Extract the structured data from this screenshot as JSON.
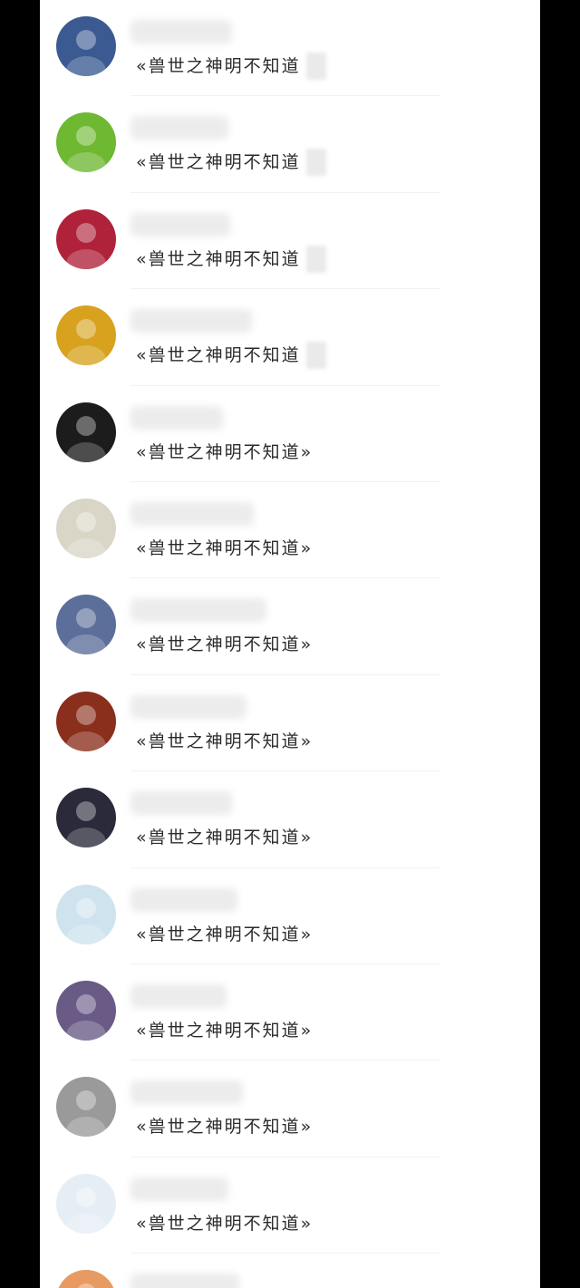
{
  "contacts": [
    {
      "song": "«兽世之神明不知道",
      "avatar_color": "#3c5a92",
      "avatar_icon": "girl-portrait-icon"
    },
    {
      "song": "«兽世之神明不知道",
      "avatar_color": "#6fb832",
      "avatar_icon": "green-leaves-icon"
    },
    {
      "song": "«兽世之神明不知道",
      "avatar_color": "#b0223a",
      "avatar_icon": "lips-icon"
    },
    {
      "song": "«兽世之神明不知道",
      "avatar_color": "#d8a21e",
      "avatar_icon": "golden-light-icon"
    },
    {
      "song": "«兽世之神明不知道»",
      "avatar_color": "#1c1c1c",
      "avatar_icon": "statue-icon"
    },
    {
      "song": "«兽世之神明不知道»",
      "avatar_color": "#d9d6c8",
      "avatar_icon": "flowers-icon"
    },
    {
      "song": "«兽世之神明不知道»",
      "avatar_color": "#5b6f9a",
      "avatar_icon": "anime-boy-icon"
    },
    {
      "song": "«兽世之神明不知道»",
      "avatar_color": "#8a2f1c",
      "avatar_icon": "warrior-icon"
    },
    {
      "song": "«兽世之神明不知道»",
      "avatar_color": "#2a2a3a",
      "avatar_icon": "sunset-icon"
    },
    {
      "song": "«兽世之神明不知道»",
      "avatar_color": "#cfe3ef",
      "avatar_icon": "jar-icon"
    },
    {
      "song": "«兽世之神明不知道»",
      "avatar_color": "#6a5a86",
      "avatar_icon": "couple-icon"
    },
    {
      "song": "«兽世之神明不知道»",
      "avatar_color": "#9a9a9a",
      "avatar_icon": "clouds-icon"
    },
    {
      "song": "«兽世之神明不知道»",
      "avatar_color": "#e6eef5",
      "avatar_icon": "anime-girl-icon"
    },
    {
      "song": "",
      "avatar_color": "#e79a61",
      "avatar_icon": "sky-icon"
    }
  ]
}
